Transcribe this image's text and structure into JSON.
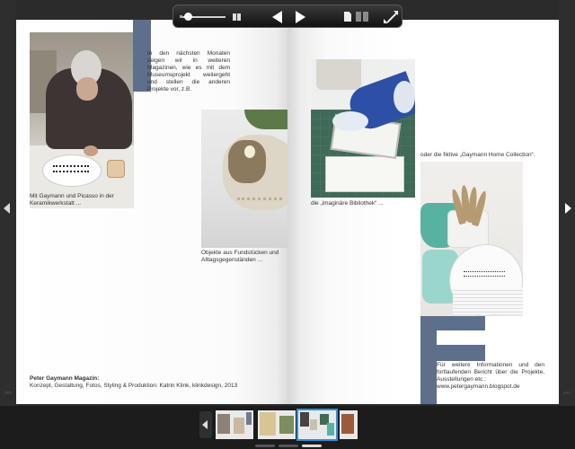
{
  "toolbar": {
    "zoom_slider_value": 0.1,
    "controls": [
      "pause",
      "previous-page",
      "next-page",
      "single-page-view",
      "double-page-view",
      "fullscreen"
    ]
  },
  "left_page": {
    "intro_text": "In den nächsten Monaten zeigen wir in weiteren Magazinen, wie es mit dem Museumsprojekt weitergeht und stellen die anderen Projekte vor, z.B.",
    "caption_1": "Mit Gaymann und Picasso in der Keramikwerkstatt ...",
    "caption_2": "Objekte aus Fundstücken und Alltagsgegenständen ...",
    "footer_title": "Peter Gaymann Magazin:",
    "footer_credits": "Konzept, Gestaltung, Fotos, Styling & Produktion: Katrin Klink, klinkdesign, 2013"
  },
  "right_page": {
    "caption_3": "die „imaginäre Bibliothek“ ...",
    "caption_4": "oder die fiktive „Gaymann Home Collection“.",
    "outro_text": "Für weitere Informationen und den fortlaufenden Bericht über die Projekte, Ausstellungen etc.:",
    "outro_link": "www.petergaymann.blogspot.de"
  },
  "thumbnails": {
    "count": 4,
    "selected_index": 2,
    "pager_count": 3,
    "pager_active": 2
  },
  "colors": {
    "slate_accent": "#5d6f8a",
    "selection": "#2f8fdc",
    "background": "#2b2b2b"
  }
}
